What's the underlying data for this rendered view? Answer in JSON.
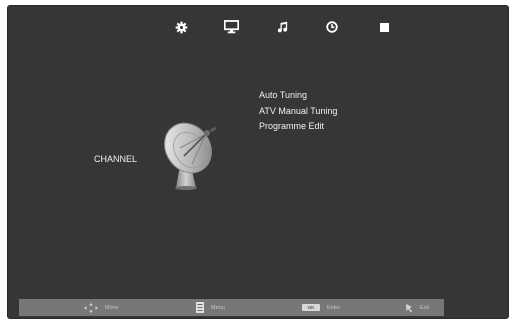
{
  "tabs": [
    {
      "name": "tab-setup",
      "icon": "gear-icon"
    },
    {
      "name": "tab-channel",
      "icon": "monitor-icon",
      "selected": true
    },
    {
      "name": "tab-sound",
      "icon": "music-note-icon"
    },
    {
      "name": "tab-time",
      "icon": "clock-icon"
    },
    {
      "name": "tab-lock",
      "icon": "square-icon"
    }
  ],
  "section": {
    "title": "CHANNEL",
    "icon": "satellite-dish-icon"
  },
  "menu": {
    "items": [
      "Auto Tuning",
      "ATV Manual Tuning",
      "Programme Edit"
    ]
  },
  "footer": {
    "move": {
      "icon": "dpad-arrows-icon",
      "label": "Move"
    },
    "menu": {
      "icon": "menu-button-icon",
      "label": "Menu"
    },
    "enter": {
      "icon": "ok-button-icon",
      "key": "OK",
      "label": "Enter"
    },
    "exit": {
      "icon": "exit-arrow-icon",
      "label": "Exit"
    }
  },
  "colors": {
    "background": "#363636",
    "footer": "#777777",
    "text": "#f2f2f2"
  }
}
